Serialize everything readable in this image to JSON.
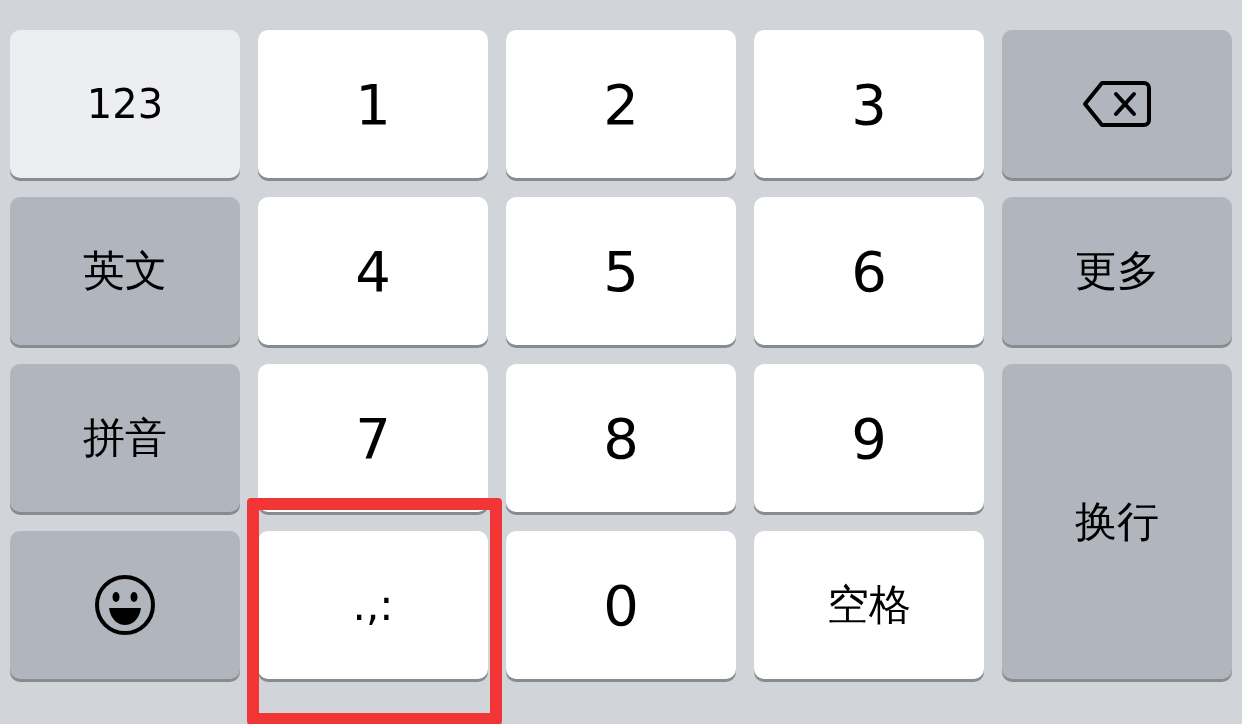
{
  "keyboard": {
    "keys": [
      {
        "kind": "mode",
        "label": "123",
        "highlighted": false
      },
      {
        "kind": "char",
        "label": "1",
        "highlighted": false
      },
      {
        "kind": "char",
        "label": "2",
        "highlighted": false
      },
      {
        "kind": "char",
        "label": "3",
        "highlighted": false
      },
      {
        "kind": "backspace",
        "highlighted": false
      },
      {
        "kind": "function",
        "label": "英文",
        "highlighted": false
      },
      {
        "kind": "char",
        "label": "4",
        "highlighted": false
      },
      {
        "kind": "char",
        "label": "5",
        "highlighted": false
      },
      {
        "kind": "char",
        "label": "6",
        "highlighted": false
      },
      {
        "kind": "function",
        "label": "更多",
        "highlighted": false
      },
      {
        "kind": "function",
        "label": "拼音",
        "highlighted": false
      },
      {
        "kind": "char",
        "label": "7",
        "highlighted": false
      },
      {
        "kind": "char",
        "label": "8",
        "highlighted": false
      },
      {
        "kind": "char",
        "label": "9",
        "highlighted": false
      },
      {
        "kind": "return",
        "label": "换行",
        "highlighted": false
      },
      {
        "kind": "emoji",
        "highlighted": false
      },
      {
        "kind": "symbol",
        "label": ".,:",
        "highlighted": true
      },
      {
        "kind": "char",
        "label": "0",
        "highlighted": false
      },
      {
        "kind": "symbol",
        "label": "空格",
        "highlighted": false
      }
    ]
  }
}
